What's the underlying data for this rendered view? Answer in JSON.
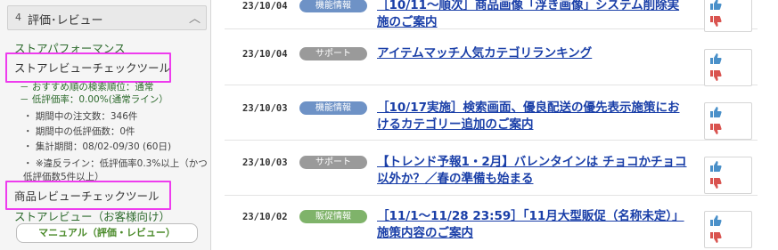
{
  "sidebar": {
    "header_num": "4",
    "header_title": "評価･レビュー",
    "items": {
      "store_performance": "ストアパフォーマンス",
      "store_review_tool": "ストアレビューチェックツール",
      "product_review_tool": "商品レビューチェックツール",
      "store_review_customer": "ストアレビュー（お客様向け）"
    },
    "store_review_details": {
      "line1": "－ おすすめ順の検索順位：通常",
      "line2": "－ 低評価率：0.00%(通常ライン）",
      "line3": "・ 期間中の注文数：346件",
      "line4": "・ 期間中の低評価数：0件",
      "line5": "・ 集計期間：08/02-09/30 (60日)",
      "line6": "・ ※違反ライン：低評価率0.3%以上（かつ",
      "line7": "低評価数5件以上）"
    },
    "manual_button": "マニュアル（評価・レビュー）"
  },
  "news": [
    {
      "date": "23/10/04",
      "badge": "機能情報",
      "badge_type": "feature",
      "title": "［10/11～順次］商品画像「浮き画像」システム削除実施のご案内"
    },
    {
      "date": "23/10/04",
      "badge": "サポート",
      "badge_type": "support",
      "title": "アイテムマッチ人気カテゴリランキング"
    },
    {
      "date": "23/10/03",
      "badge": "機能情報",
      "badge_type": "feature",
      "title": "［10/17実施］検索画面、優良配送の優先表示施策におけるカテゴリー追加のご案内"
    },
    {
      "date": "23/10/03",
      "badge": "サポート",
      "badge_type": "support",
      "title": "【トレンド予報1・2月】バレンタインは チョコかチョコ以外か？／春の準備も始まる"
    },
    {
      "date": "23/10/02",
      "badge": "販促情報",
      "badge_type": "promo",
      "title": "［11/1～11/28 23:59］「11月大型販促（名称未定）」施策内容のご案内"
    }
  ],
  "colors": {
    "highlight": "#ee3cee",
    "link": "#1a3fa8",
    "badge_feature": "#6e92c6",
    "badge_support": "#9a9a9a",
    "badge_promo": "#7fb36a",
    "thumb_up": "#4a90c9",
    "thumb_down": "#d9534f"
  }
}
